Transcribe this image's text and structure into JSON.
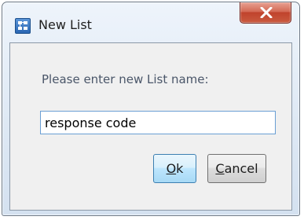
{
  "window": {
    "title": "New List",
    "icon": "list-app-icon",
    "close_icon": "close-icon"
  },
  "dialog": {
    "prompt": "Please enter new List name:",
    "input_value": "response code"
  },
  "buttons": {
    "ok_mnemonic": "O",
    "ok_rest": "k",
    "cancel_mnemonic": "C",
    "cancel_rest": "ancel"
  },
  "colors": {
    "close_button": "#c7452e",
    "ok_button_border": "#3c7fb1",
    "input_border": "#6a9fd4"
  }
}
